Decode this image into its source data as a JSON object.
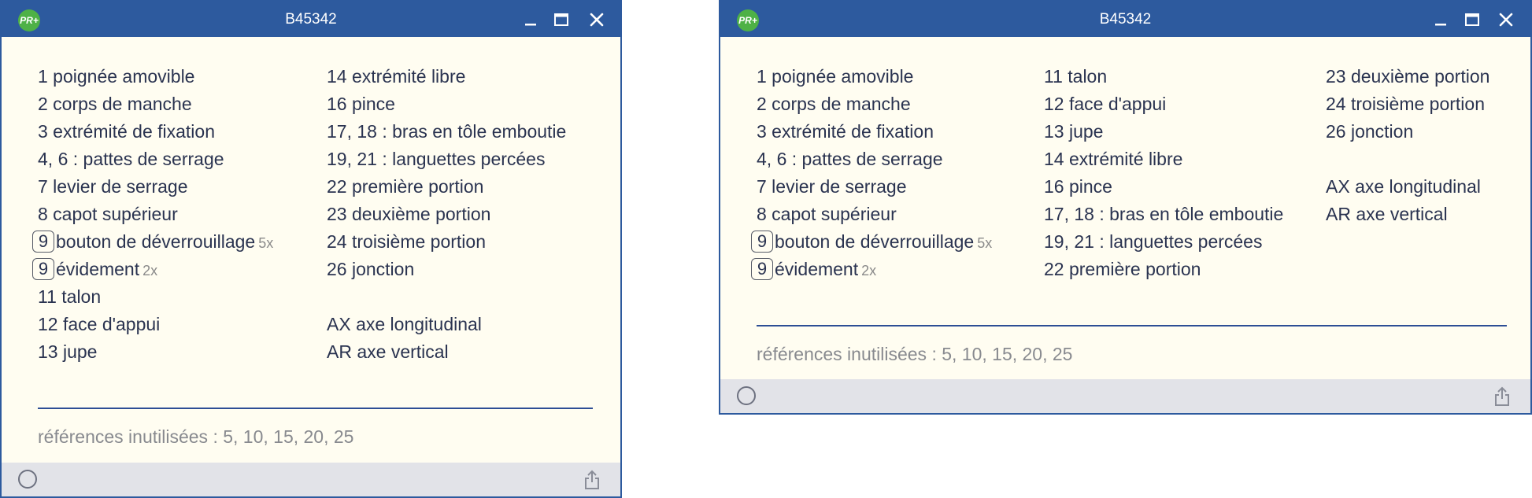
{
  "windows": [
    {
      "title": "B45342",
      "columns": [
        [
          {
            "badge": "",
            "text": "1  poignée amovible",
            "mult": ""
          },
          {
            "badge": "",
            "text": "2  corps de manche",
            "mult": ""
          },
          {
            "badge": "",
            "text": "3  extrémité de fixation",
            "mult": ""
          },
          {
            "badge": "",
            "text": "4, 6 :  pattes de serrage",
            "mult": ""
          },
          {
            "badge": "",
            "text": "7  levier de serrage",
            "mult": ""
          },
          {
            "badge": "",
            "text": "8  capot supérieur",
            "mult": ""
          },
          {
            "badge": "9",
            "text": "bouton de déverrouillage",
            "mult": "5x"
          },
          {
            "badge": "9",
            "text": "évidement",
            "mult": "2x"
          },
          {
            "badge": "",
            "text": "11  talon",
            "mult": ""
          },
          {
            "badge": "",
            "text": "12  face d'appui",
            "mult": ""
          },
          {
            "badge": "",
            "text": "13  jupe",
            "mult": ""
          }
        ],
        [
          {
            "badge": "",
            "text": "14  extrémité libre",
            "mult": ""
          },
          {
            "badge": "",
            "text": "16  pince",
            "mult": ""
          },
          {
            "badge": "",
            "text": "17, 18 :  bras en tôle emboutie",
            "mult": ""
          },
          {
            "badge": "",
            "text": "19, 21 :  languettes percées",
            "mult": ""
          },
          {
            "badge": "",
            "text": "22  première portion",
            "mult": ""
          },
          {
            "badge": "",
            "text": "23  deuxième portion",
            "mult": ""
          },
          {
            "badge": "",
            "text": "24  troisième portion",
            "mult": ""
          },
          {
            "badge": "",
            "text": "26  jonction",
            "mult": ""
          },
          {
            "badge": "",
            "text": "",
            "mult": ""
          },
          {
            "badge": "",
            "text": "AX  axe longitudinal",
            "mult": ""
          },
          {
            "badge": "",
            "text": "AR  axe vertical",
            "mult": ""
          }
        ]
      ],
      "unused": "références inutilisées : 5, 10, 15, 20, 25"
    },
    {
      "title": "B45342",
      "columns": [
        [
          {
            "badge": "",
            "text": "1  poignée amovible",
            "mult": ""
          },
          {
            "badge": "",
            "text": "2  corps de manche",
            "mult": ""
          },
          {
            "badge": "",
            "text": "3  extrémité de fixation",
            "mult": ""
          },
          {
            "badge": "",
            "text": "4, 6 :  pattes de serrage",
            "mult": ""
          },
          {
            "badge": "",
            "text": "7  levier de serrage",
            "mult": ""
          },
          {
            "badge": "",
            "text": "8  capot supérieur",
            "mult": ""
          },
          {
            "badge": "9",
            "text": "bouton de déverrouillage",
            "mult": "5x"
          },
          {
            "badge": "9",
            "text": "évidement",
            "mult": "2x"
          }
        ],
        [
          {
            "badge": "",
            "text": "11  talon",
            "mult": ""
          },
          {
            "badge": "",
            "text": "12  face d'appui",
            "mult": ""
          },
          {
            "badge": "",
            "text": "13  jupe",
            "mult": ""
          },
          {
            "badge": "",
            "text": "14  extrémité libre",
            "mult": ""
          },
          {
            "badge": "",
            "text": "16  pince",
            "mult": ""
          },
          {
            "badge": "",
            "text": "17, 18 :  bras en tôle emboutie",
            "mult": ""
          },
          {
            "badge": "",
            "text": "19, 21 :  languettes percées",
            "mult": ""
          },
          {
            "badge": "",
            "text": "22 première portion",
            "mult": ""
          }
        ],
        [
          {
            "badge": "",
            "text": "23  deuxième portion",
            "mult": ""
          },
          {
            "badge": "",
            "text": "24  troisième portion",
            "mult": ""
          },
          {
            "badge": "",
            "text": "26  jonction",
            "mult": ""
          },
          {
            "badge": "",
            "text": "",
            "mult": ""
          },
          {
            "badge": "",
            "text": "AX  axe longitudinal",
            "mult": ""
          },
          {
            "badge": "",
            "text": "AR  axe vertical",
            "mult": ""
          }
        ]
      ],
      "unused": "références inutilisées : 5, 10, 15, 20, 25"
    }
  ],
  "icons": {
    "app_logo": "PR+",
    "minimize": "minimize-icon",
    "maximize": "maximize-icon",
    "close": "close-icon",
    "status": "circle-icon",
    "share": "share-icon"
  },
  "colors": {
    "titlebar": "#2d5a9e",
    "background": "#fffdf1",
    "footer": "#e2e3e8",
    "logo": "#4eb146",
    "text": "#2a3350",
    "muted": "#888a8f"
  }
}
